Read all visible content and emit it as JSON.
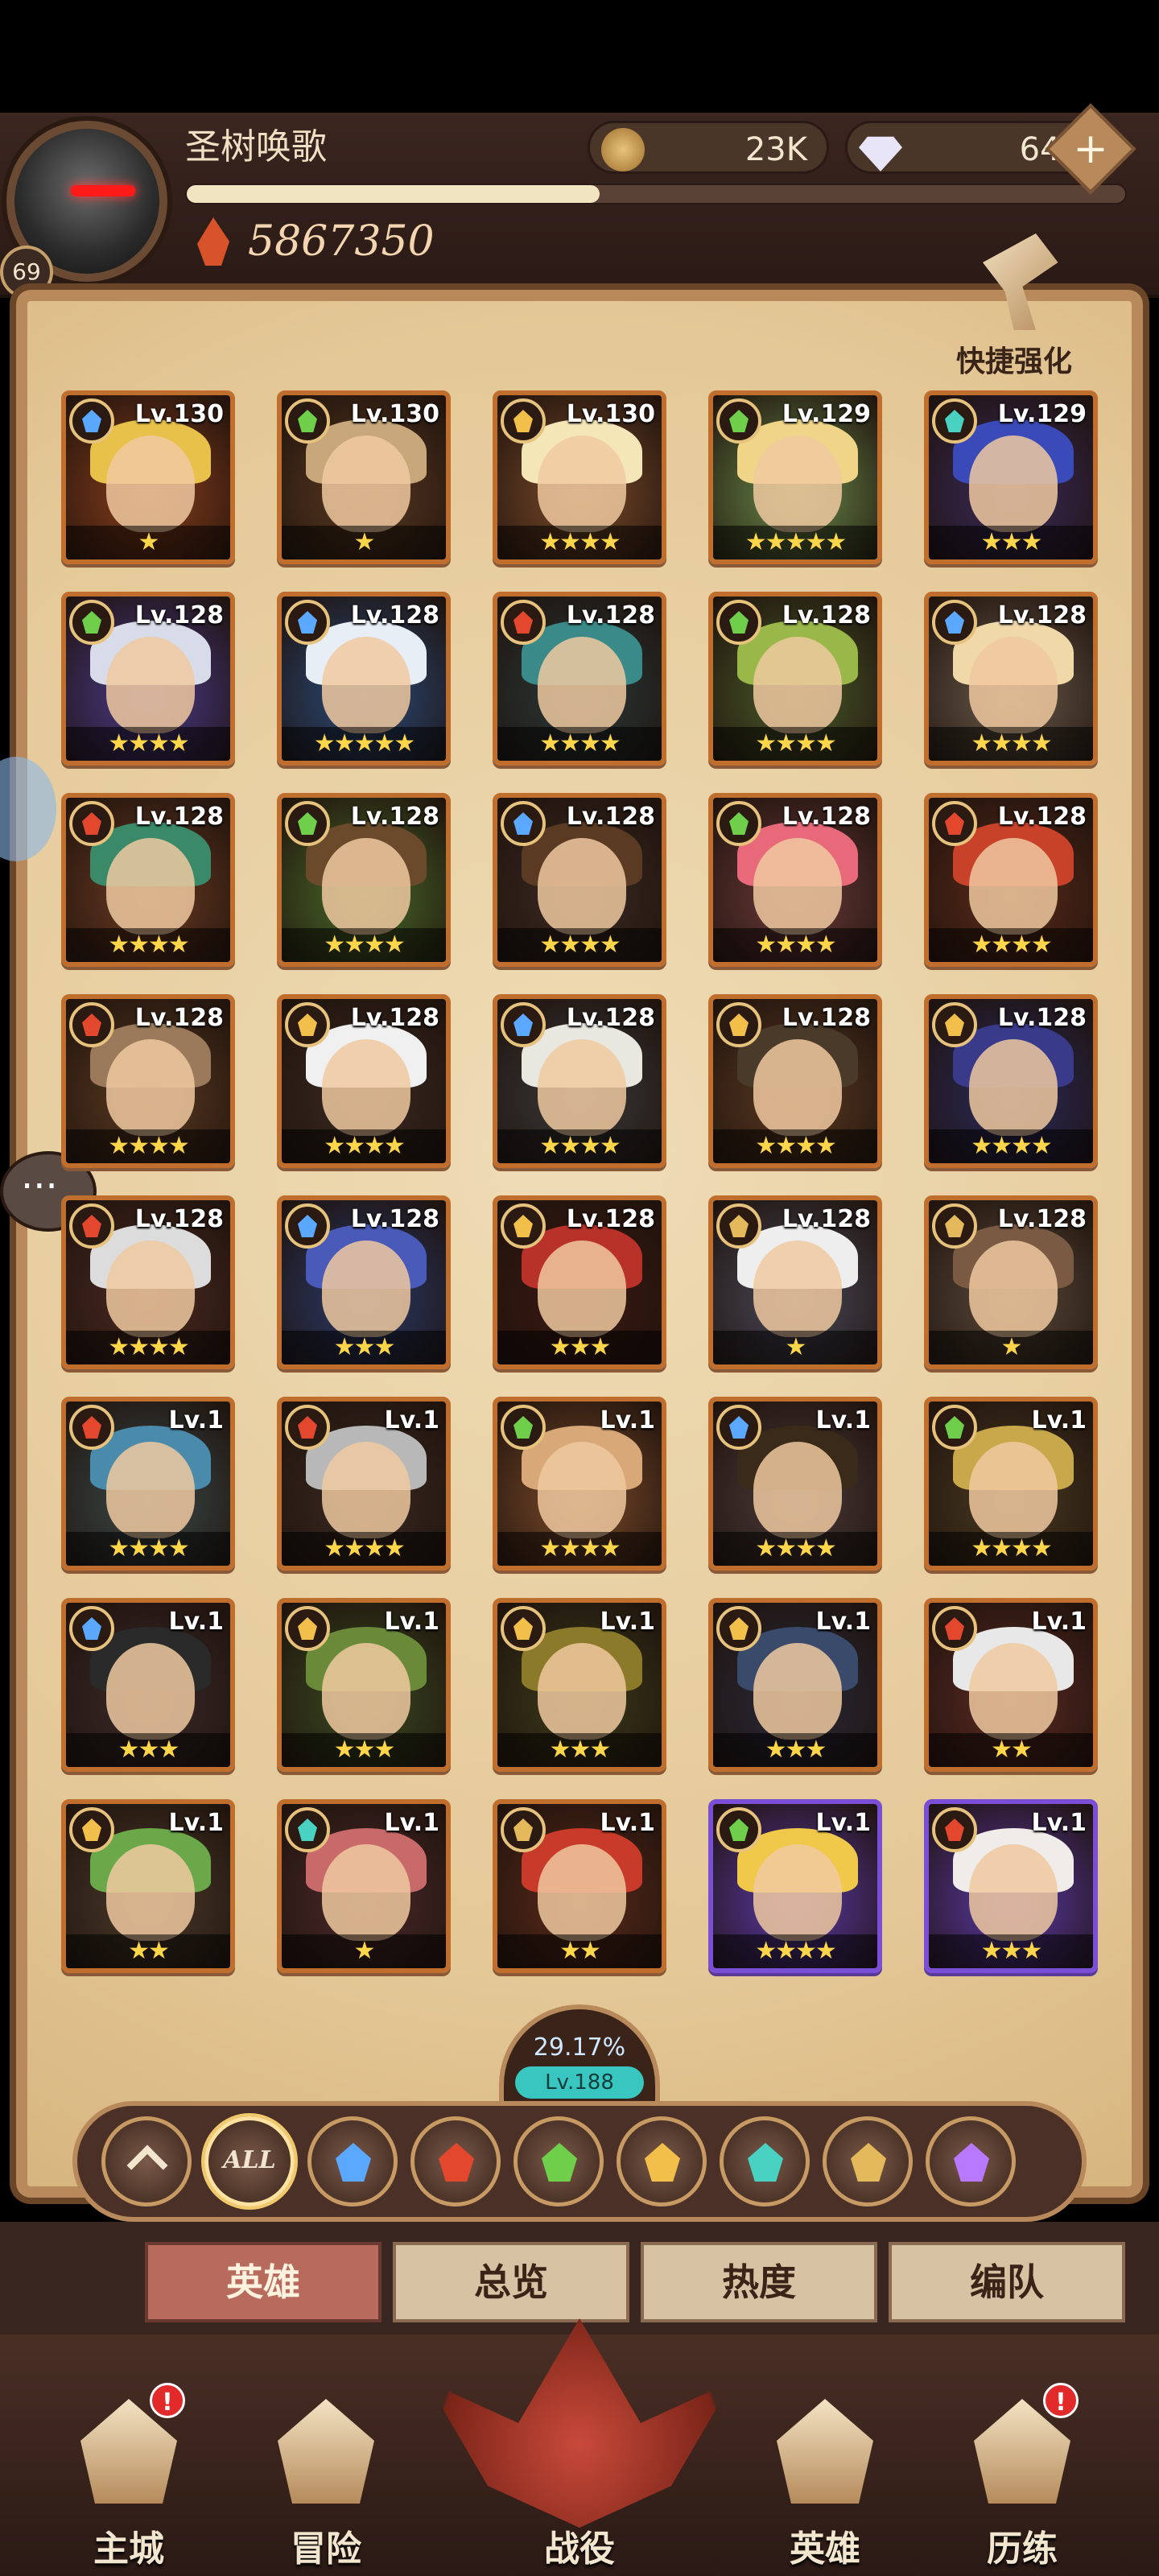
{
  "player": {
    "name": "圣树唤歌",
    "level": "69",
    "power": "5867350",
    "xp_fraction": 0.44
  },
  "currency": {
    "gold": "23K",
    "gems": "643",
    "add_label": "+"
  },
  "quick_enhance": {
    "label": "快捷强化"
  },
  "heroes": [
    {
      "level": "Lv.130",
      "stars": "★",
      "faction": "water",
      "hair": "#e8c14a",
      "bg": "#8a3e1c"
    },
    {
      "level": "Lv.130",
      "stars": "★",
      "faction": "nature",
      "hair": "#c8a87a",
      "bg": "#5a3a22"
    },
    {
      "level": "Lv.130",
      "stars": "★★★★",
      "faction": "light",
      "hair": "#f5e6b8",
      "bg": "#7a4a2a"
    },
    {
      "level": "Lv.129",
      "stars": "★★★★★",
      "faction": "nature",
      "hair": "#f0d488",
      "bg": "#6a8a4a"
    },
    {
      "level": "Lv.129",
      "stars": "★★★",
      "faction": "eye",
      "hair": "#3a4ab8",
      "bg": "#3a2a5a"
    },
    {
      "level": "Lv.128",
      "stars": "★★★★",
      "faction": "nature",
      "hair": "#d8dce8",
      "bg": "#4a3a8a"
    },
    {
      "level": "Lv.128",
      "stars": "★★★★★",
      "faction": "water",
      "hair": "#e8eef6",
      "bg": "#2a4a7a"
    },
    {
      "level": "Lv.128",
      "stars": "★★★★",
      "faction": "fire",
      "hair": "#3a8a8a",
      "bg": "#2a3a3a"
    },
    {
      "level": "Lv.128",
      "stars": "★★★★",
      "faction": "nature",
      "hair": "#9ab84a",
      "bg": "#4a5a2a"
    },
    {
      "level": "Lv.128",
      "stars": "★★★★",
      "faction": "water",
      "hair": "#f0d8a8",
      "bg": "#6a5a4a"
    },
    {
      "level": "Lv.128",
      "stars": "★★★★",
      "faction": "fire",
      "hair": "#3a8a6a",
      "bg": "#6a3a22"
    },
    {
      "level": "Lv.128",
      "stars": "★★★★",
      "faction": "nature",
      "hair": "#6a4a2a",
      "bg": "#4a6a2a"
    },
    {
      "level": "Lv.128",
      "stars": "★★★★",
      "faction": "water",
      "hair": "#5a3a22",
      "bg": "#3a2a22"
    },
    {
      "level": "Lv.128",
      "stars": "★★★★",
      "faction": "nature",
      "hair": "#e86a7a",
      "bg": "#6a3a3a"
    },
    {
      "level": "Lv.128",
      "stars": "★★★★",
      "faction": "fire",
      "hair": "#c8422a",
      "bg": "#5a2a1a"
    },
    {
      "level": "Lv.128",
      "stars": "★★★★",
      "faction": "fire",
      "hair": "#9a7a5a",
      "bg": "#5a3a22"
    },
    {
      "level": "Lv.128",
      "stars": "★★★★",
      "faction": "light",
      "hair": "#f0f0f0",
      "bg": "#3a2a22"
    },
    {
      "level": "Lv.128",
      "stars": "★★★★",
      "faction": "water",
      "hair": "#e8e8e0",
      "bg": "#3a3a3a"
    },
    {
      "level": "Lv.128",
      "stars": "★★★★",
      "faction": "light",
      "hair": "#4a3a2a",
      "bg": "#5a3a22"
    },
    {
      "level": "Lv.128",
      "stars": "★★★★",
      "faction": "light",
      "hair": "#3a3a8a",
      "bg": "#2a2a5a"
    },
    {
      "level": "Lv.128",
      "stars": "★★★★",
      "faction": "fire",
      "hair": "#dcdcdc",
      "bg": "#4a2a22"
    },
    {
      "level": "Lv.128",
      "stars": "★★★",
      "faction": "water",
      "hair": "#4a5ab8",
      "bg": "#2a3a6a"
    },
    {
      "level": "Lv.128",
      "stars": "★★★",
      "faction": "light",
      "hair": "#b8322a",
      "bg": "#3a1a12"
    },
    {
      "level": "Lv.128",
      "stars": "★",
      "faction": "gold",
      "hair": "#eeeeee",
      "bg": "#4a4a5a"
    },
    {
      "level": "Lv.128",
      "stars": "★",
      "faction": "gold",
      "hair": "#7a5a42",
      "bg": "#5a4a3a"
    },
    {
      "level": "Lv.1",
      "stars": "★★★★",
      "faction": "fire",
      "hair": "#4a8aaa",
      "bg": "#3a4a4a"
    },
    {
      "level": "Lv.1",
      "stars": "★★★★",
      "faction": "fire",
      "hair": "#b8b8b8",
      "bg": "#3a2a22"
    },
    {
      "level": "Lv.1",
      "stars": "★★★★",
      "faction": "nature",
      "hair": "#d8a878",
      "bg": "#7a4a2a"
    },
    {
      "level": "Lv.1",
      "stars": "★★★★",
      "faction": "water",
      "hair": "#3a2a1a",
      "bg": "#4a3a3a"
    },
    {
      "level": "Lv.1",
      "stars": "★★★★",
      "faction": "nature",
      "hair": "#c8a84a",
      "bg": "#4a3a22"
    },
    {
      "level": "Lv.1",
      "stars": "★★★",
      "faction": "water",
      "hair": "#2a2a2a",
      "bg": "#3a2a2a"
    },
    {
      "level": "Lv.1",
      "stars": "★★★",
      "faction": "light",
      "hair": "#6a8a3a",
      "bg": "#3a4a22"
    },
    {
      "level": "Lv.1",
      "stars": "★★★",
      "faction": "light",
      "hair": "#8a7a2a",
      "bg": "#3a3a1a"
    },
    {
      "level": "Lv.1",
      "stars": "★★★",
      "faction": "light",
      "hair": "#3a4a6a",
      "bg": "#2a2a3a"
    },
    {
      "level": "Lv.1",
      "stars": "★★",
      "faction": "fire",
      "hair": "#e8e8e8",
      "bg": "#5a2a22"
    },
    {
      "level": "Lv.1",
      "stars": "★★",
      "faction": "light",
      "hair": "#6aa84a",
      "bg": "#4a3a2a"
    },
    {
      "level": "Lv.1",
      "stars": "★",
      "faction": "eye",
      "hair": "#c86a6a",
      "bg": "#4a2a2a"
    },
    {
      "level": "Lv.1",
      "stars": "★★",
      "faction": "gold",
      "hair": "#c83a2a",
      "bg": "#5a2a1a"
    },
    {
      "level": "Lv.1",
      "stars": "★★★★",
      "faction": "nature",
      "hair": "#f0c84a",
      "bg": "#5a3aa8",
      "purple": true
    },
    {
      "level": "Lv.1",
      "stars": "★★★",
      "faction": "fire",
      "hair": "#f0ecea",
      "bg": "#5a3aa8",
      "purple": true
    }
  ],
  "progress": {
    "percent": "29.17%",
    "level": "Lv.188"
  },
  "filters": [
    {
      "kind": "collapse",
      "label": ""
    },
    {
      "kind": "all",
      "label": "ALL"
    },
    {
      "kind": "water",
      "label": ""
    },
    {
      "kind": "fire",
      "label": ""
    },
    {
      "kind": "nature",
      "label": ""
    },
    {
      "kind": "light",
      "label": ""
    },
    {
      "kind": "eye",
      "label": ""
    },
    {
      "kind": "gold",
      "label": ""
    },
    {
      "kind": "void",
      "label": ""
    }
  ],
  "filter_colors": {
    "water": "#5aa8ff",
    "fire": "#e3472e",
    "nature": "#6fcf4a",
    "light": "#f2c04a",
    "eye": "#49d1c2",
    "gold": "#e4b95b",
    "void": "#b879ff"
  },
  "tabs": [
    {
      "label": "英雄",
      "active": true
    },
    {
      "label": "总览",
      "active": false
    },
    {
      "label": "热度",
      "active": false
    },
    {
      "label": "编队",
      "active": false
    }
  ],
  "nav": {
    "city": "主城",
    "adventure": "冒险",
    "campaign": "战役",
    "heroes": "英雄",
    "trials": "历练",
    "alert_mark": "!"
  }
}
